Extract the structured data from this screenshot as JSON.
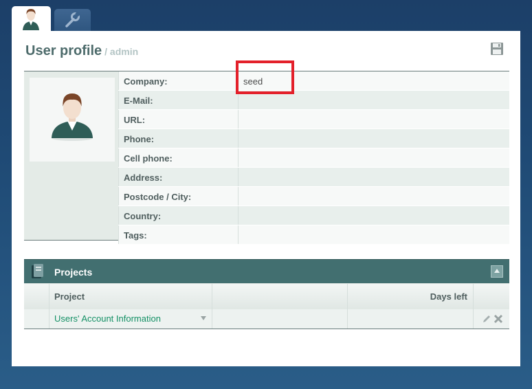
{
  "tabs": [
    {
      "icon": "user-icon"
    },
    {
      "icon": "wrench-icon"
    }
  ],
  "header": {
    "title": "User profile",
    "subtitle": "/ admin",
    "save_icon": "floppy-disk-icon"
  },
  "profile": {
    "fields": [
      {
        "label": "Company:",
        "value": "seed"
      },
      {
        "label": "E-Mail:",
        "value": ""
      },
      {
        "label": "URL:",
        "value": ""
      },
      {
        "label": "Phone:",
        "value": ""
      },
      {
        "label": "Cell phone:",
        "value": ""
      },
      {
        "label": "Address:",
        "value": ""
      },
      {
        "label": "Postcode / City:",
        "value": ""
      },
      {
        "label": "Country:",
        "value": ""
      },
      {
        "label": "Tags:",
        "value": ""
      }
    ]
  },
  "projects": {
    "title": "Projects",
    "columns": {
      "project": "Project",
      "days_left": "Days left"
    },
    "rows": [
      {
        "project": "Users' Account Information",
        "days_left": ""
      }
    ]
  },
  "colors": {
    "background": "#1f4a75",
    "header_bar": "#426f70",
    "link": "#149065",
    "highlight": "#e3202a"
  }
}
